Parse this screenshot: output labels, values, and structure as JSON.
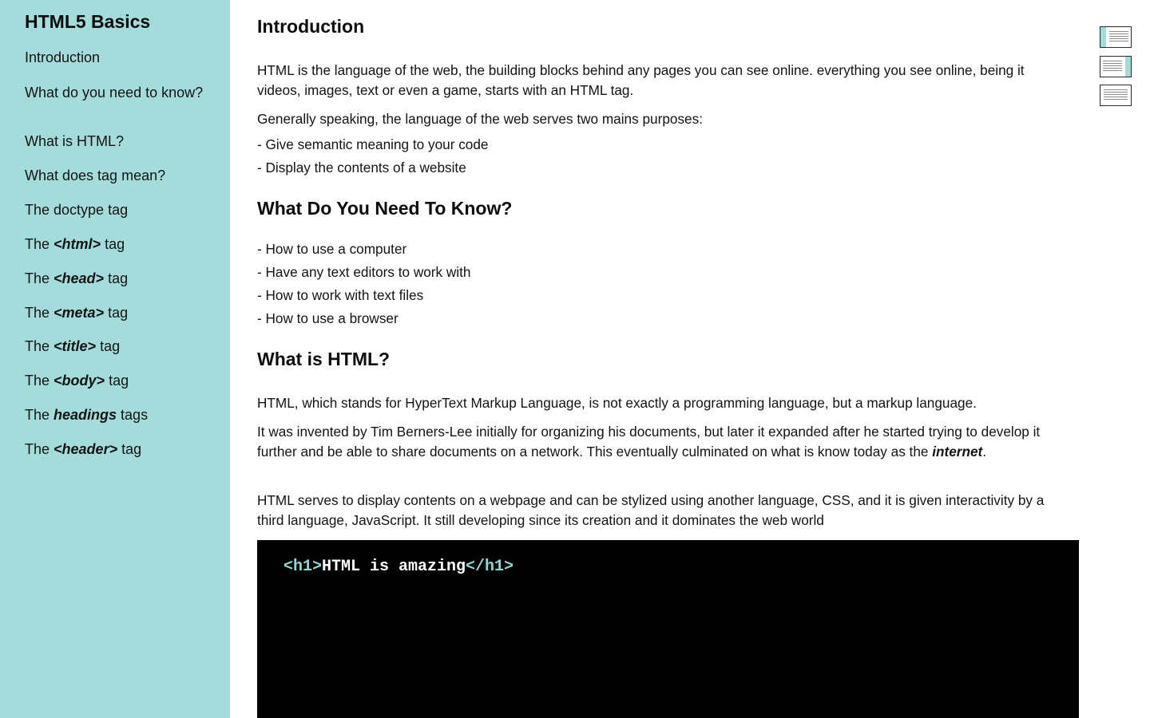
{
  "sidebar": {
    "title": "HTML5 Basics",
    "items": [
      {
        "pre": "Introduction",
        "em": "",
        "post": ""
      },
      {
        "pre": "What do you need to know?",
        "em": "",
        "post": ""
      },
      {
        "pre": "What is HTML?",
        "em": "",
        "post": ""
      },
      {
        "pre": "What does tag mean?",
        "em": "",
        "post": ""
      },
      {
        "pre": "The doctype tag",
        "em": "",
        "post": ""
      },
      {
        "pre": "The ",
        "em": "<html>",
        "post": " tag"
      },
      {
        "pre": "The ",
        "em": "<head>",
        "post": " tag"
      },
      {
        "pre": "The ",
        "em": "<meta>",
        "post": " tag"
      },
      {
        "pre": "The ",
        "em": "<title>",
        "post": " tag"
      },
      {
        "pre": "The ",
        "em": "<body>",
        "post": " tag"
      },
      {
        "pre": "The ",
        "em": "headings",
        "post": " tags"
      },
      {
        "pre": "The ",
        "em": "<header>",
        "post": " tag"
      }
    ]
  },
  "main": {
    "intro": {
      "heading": "Introduction",
      "p1": "HTML is the language of the web, the building blocks behind any pages you can see online. everything you see online, being it videos, images, text or even a game, starts with an HTML tag.",
      "p2": "Generally speaking, the language of the web serves two mains purposes:",
      "list": [
        "- Give semantic meaning to your code",
        "- Display the contents of a website"
      ]
    },
    "need": {
      "heading": "What Do You Need To Know?",
      "list": [
        "- How to use a computer",
        "- Have any text editors to work with",
        "- How to work with text files",
        "- How to use a browser"
      ]
    },
    "what": {
      "heading": "What is HTML?",
      "p1": "HTML, which stands for HyperText Markup Language, is not exactly a programming language, but a markup language.",
      "p2_pre": "It was invented by Tim Berners-Lee initially for organizing his documents, but later it expanded after he started trying to develop it further and be able to share documents on a network. This eventually culminated on what is know today as the ",
      "p2_em": "internet",
      "p2_post": ".",
      "p3": "HTML serves to display contents on a webpage and can be stylized using another language, CSS, and it is given interactivity by a third language, JavaScript. It still developing since its creation and it dominates the web world"
    },
    "code": {
      "open_tag": "<h1>",
      "text": "HTML is amazing",
      "close_tag": "</h1>"
    }
  },
  "layout_switcher": {
    "options": [
      "sidebar-left-icon",
      "sidebar-right-icon",
      "no-sidebar-icon"
    ]
  },
  "colors": {
    "sidebar_bg": "#a3dcdb",
    "code_bg": "#000000",
    "code_tag": "#8fd6d3"
  }
}
